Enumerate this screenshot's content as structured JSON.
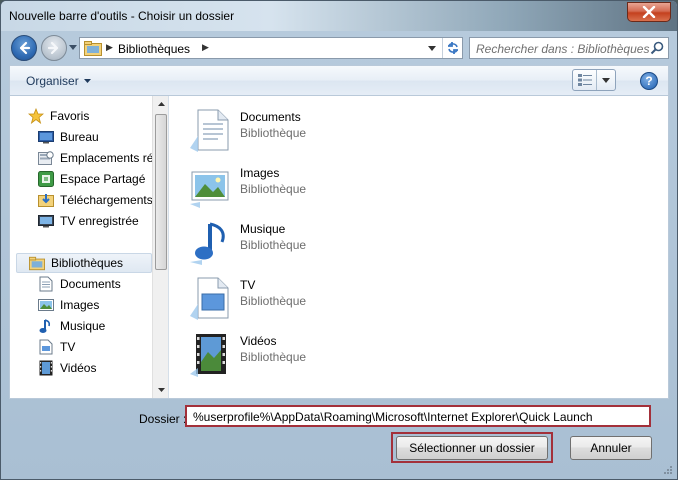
{
  "window": {
    "title": "Nouvelle barre d'outils - Choisir un dossier"
  },
  "address": {
    "crumb": "Bibliothèques",
    "separator": "▶"
  },
  "search": {
    "placeholder": "Rechercher dans : Bibliothèques"
  },
  "toolbar": {
    "organise_label": "Organiser",
    "help_label": "?"
  },
  "nav_pane": {
    "favorites_header": "Favoris",
    "favorites": [
      "Bureau",
      "Emplacements ré",
      "Espace Partagé",
      "Téléchargements",
      "TV enregistrée"
    ],
    "libraries_header": "Bibliothèques",
    "libraries": [
      "Documents",
      "Images",
      "Musique",
      "TV",
      "Vidéos"
    ]
  },
  "file_list": {
    "items": [
      {
        "name": "Documents",
        "type": "Bibliothèque"
      },
      {
        "name": "Images",
        "type": "Bibliothèque"
      },
      {
        "name": "Musique",
        "type": "Bibliothèque"
      },
      {
        "name": "TV",
        "type": "Bibliothèque"
      },
      {
        "name": "Vidéos",
        "type": "Bibliothèque"
      }
    ]
  },
  "folder": {
    "label": "Dossier :",
    "value": "%userprofile%\\AppData\\Roaming\\Microsoft\\Internet Explorer\\Quick Launch"
  },
  "buttons": {
    "select_label": "Sélectionner un dossier",
    "cancel_label": "Annuler"
  },
  "colors": {
    "highlight_border": "#a3303a",
    "accent_blue": "#2f6bb4"
  }
}
